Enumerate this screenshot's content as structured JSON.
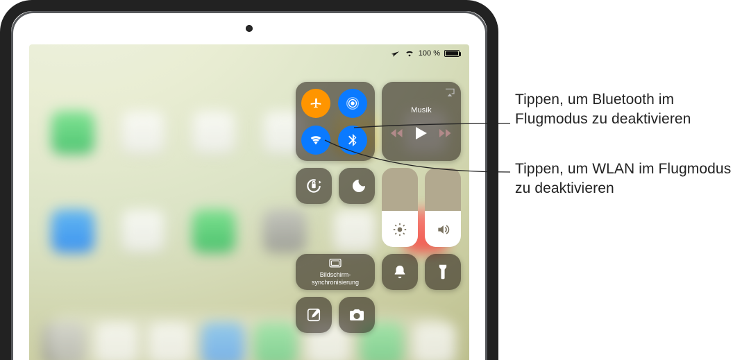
{
  "status": {
    "battery_text": "100 %"
  },
  "cc": {
    "media_label": "Musik",
    "mirror_line1": "Bildschirm-",
    "mirror_line2": "synchronisierung"
  },
  "callouts": {
    "bt": "Tippen, um Bluetooth im Flugmodus zu deaktivieren",
    "wlan": "Tippen, um WLAN im Flugmodus zu deaktivieren"
  },
  "icons": {
    "airplane": "airplane-icon",
    "airdrop": "airdrop-icon",
    "wifi": "wifi-icon",
    "bluetooth": "bluetooth-icon",
    "airplay": "airplay-icon",
    "rewind": "rewind-icon",
    "play": "play-icon",
    "forward": "forward-icon",
    "rotation_lock": "rotation-lock-icon",
    "dnd": "do-not-disturb-icon",
    "brightness": "brightness-icon",
    "volume": "volume-icon",
    "bell": "bell-icon",
    "flashlight": "flashlight-icon",
    "compose": "compose-icon",
    "camera": "camera-icon"
  }
}
